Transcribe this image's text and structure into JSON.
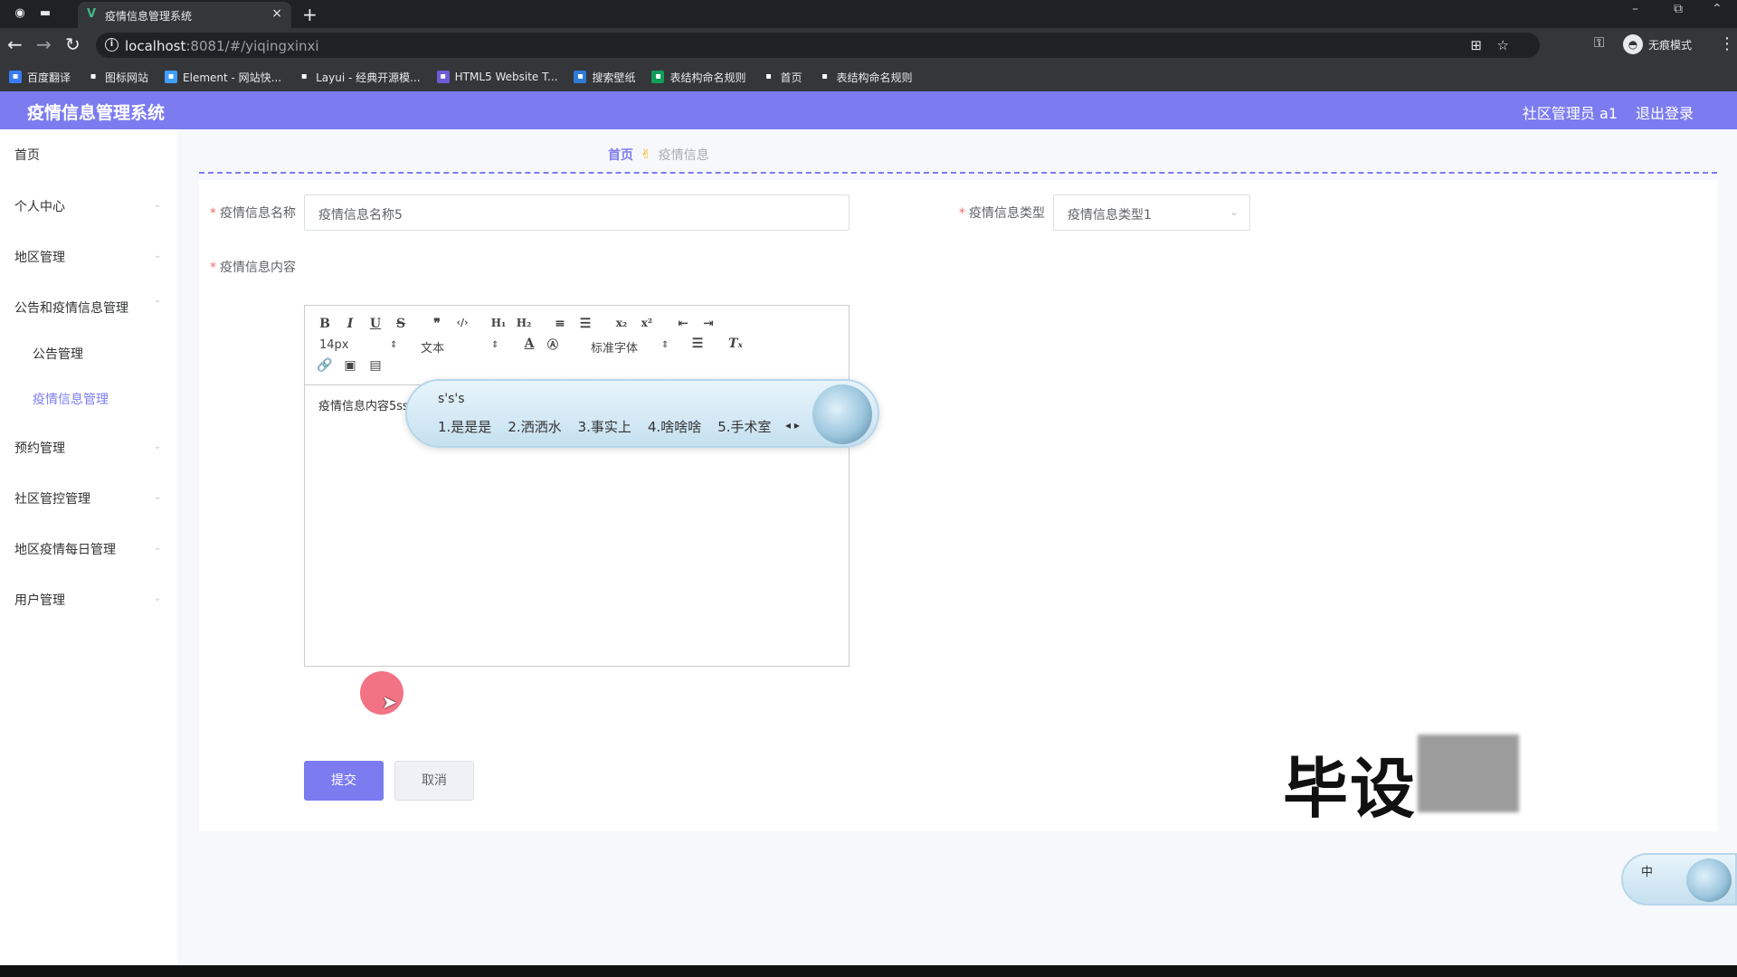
{
  "browser": {
    "tab_title": "疫情信息管理系统",
    "tab_close": "×",
    "new_tab": "+",
    "url_host": "localhost",
    "url_path": ":8081/#/yiqingxinxi",
    "incognito_label": "无痕模式",
    "bookmarks": [
      {
        "label": "百度翻译",
        "icon": "translate-icon",
        "color": "#3a7bf5"
      },
      {
        "label": "图标网站",
        "icon": "flag-icon",
        "color": "#35363a"
      },
      {
        "label": "Element - 网站快...",
        "icon": "element-logo-icon",
        "color": "#409eff"
      },
      {
        "label": "Layui - 经典开源模...",
        "icon": "layui-logo-icon",
        "color": "#35363a"
      },
      {
        "label": "HTML5 Website T...",
        "icon": "html5-template-icon",
        "color": "#6b5cd6"
      },
      {
        "label": "搜索壁纸",
        "icon": "wallpaper-search-icon",
        "color": "#2f7bd8"
      },
      {
        "label": "表结构命名规则",
        "icon": "sheet-icon",
        "color": "#0f9d58"
      },
      {
        "label": "首页",
        "icon": "globe-icon",
        "color": "#35363a"
      },
      {
        "label": "表结构命名规则",
        "icon": "globe-icon",
        "color": "#35363a"
      }
    ]
  },
  "header": {
    "title": "疫情信息管理系统",
    "user": "社区管理员 a1",
    "logout": "退出登录"
  },
  "sidebar": {
    "items": [
      {
        "label": "首页"
      },
      {
        "label": "个人中心"
      },
      {
        "label": "地区管理"
      },
      {
        "label": "公告和疫情信息管理"
      },
      {
        "label": "公告管理"
      },
      {
        "label": "疫情信息管理"
      },
      {
        "label": "预约管理"
      },
      {
        "label": "社区管控管理"
      },
      {
        "label": "地区疫情每日管理"
      },
      {
        "label": "用户管理"
      }
    ]
  },
  "breadcrumb": {
    "home": "首页",
    "current": "疫情信息"
  },
  "form": {
    "name_label": "疫情信息名称",
    "name_value": "疫情信息名称5",
    "type_label": "疫情信息类型",
    "type_value": "疫情信息类型1",
    "content_label": "疫情信息内容",
    "required_mark": "*"
  },
  "editor": {
    "font_size": "14px",
    "header_select": "文本",
    "font_family": "标准字体",
    "content": "疫情信息内容5sss"
  },
  "ime": {
    "composition": "s's's",
    "candidates": [
      "1.是是是",
      "2.洒洒水",
      "3.事实上",
      "4.啥啥啥",
      "5.手术室"
    ],
    "status_label": "中"
  },
  "buttons": {
    "submit": "提交",
    "cancel": "取消"
  },
  "watermark": "毕设",
  "colors": {
    "primary": "#7c7cf0",
    "required": "#f56c6c",
    "breadcrumb_separator": "#f0b400"
  }
}
